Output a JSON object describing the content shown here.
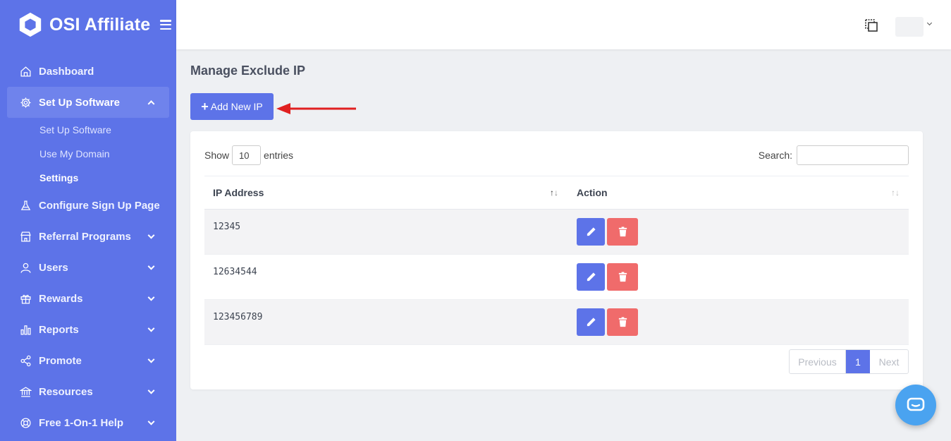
{
  "brand": {
    "name": "OSI Affiliate"
  },
  "sidebar": {
    "items": [
      {
        "label": "Dashboard",
        "icon": "home-icon"
      },
      {
        "label": "Set Up Software",
        "icon": "gear-icon",
        "expanded": true,
        "sub": [
          {
            "label": "Set Up Software"
          },
          {
            "label": "Use My Domain"
          },
          {
            "label": "Settings",
            "current": true
          }
        ]
      },
      {
        "label": "Configure Sign Up Page",
        "icon": "flask-icon"
      },
      {
        "label": "Referral Programs",
        "icon": "store-icon"
      },
      {
        "label": "Users",
        "icon": "user-icon"
      },
      {
        "label": "Rewards",
        "icon": "gift-icon"
      },
      {
        "label": "Reports",
        "icon": "bar-chart-icon"
      },
      {
        "label": "Promote",
        "icon": "share-icon"
      },
      {
        "label": "Resources",
        "icon": "bank-icon"
      },
      {
        "label": "Free 1-On-1 Help",
        "icon": "lifebuoy-icon"
      }
    ]
  },
  "main": {
    "title": "Manage Exclude IP",
    "add_button": "Add New IP",
    "show_label": "Show",
    "entries_value": "10",
    "entries_label": "entries",
    "search_label": "Search:",
    "table": {
      "columns": [
        "IP Address",
        "Action"
      ],
      "rows": [
        {
          "ip": "12345"
        },
        {
          "ip": "12634544"
        },
        {
          "ip": "123456789"
        }
      ]
    },
    "pagination": {
      "previous": "Previous",
      "page": "1",
      "next": "Next"
    }
  },
  "colors": {
    "primary": "#5d73e8",
    "danger": "#f06b6b",
    "chat": "#4aa3f0",
    "arrow": "#e02020"
  }
}
